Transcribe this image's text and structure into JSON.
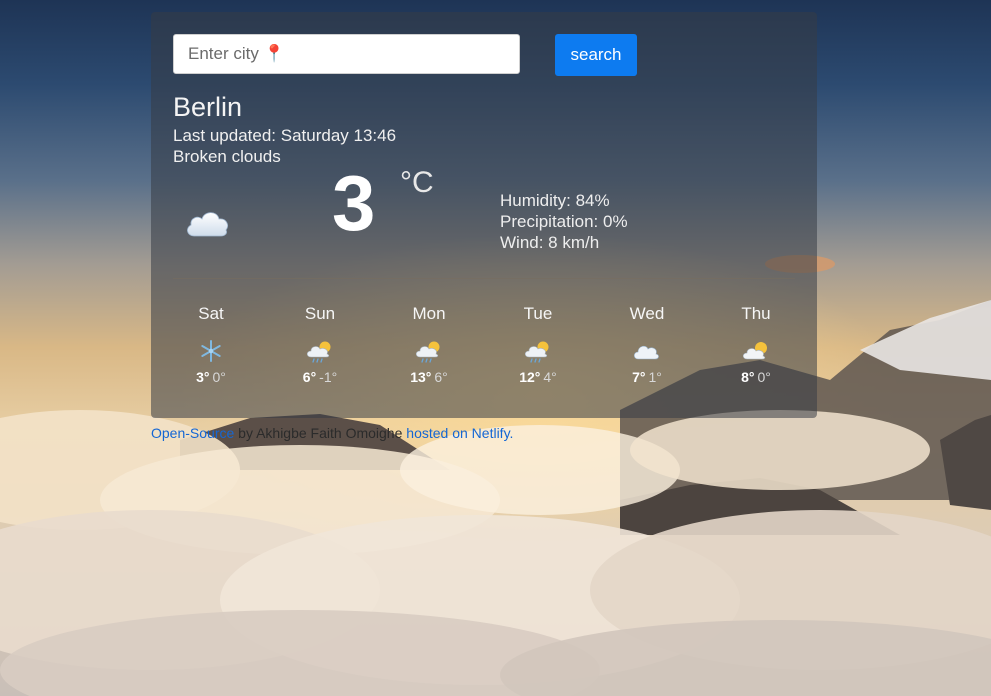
{
  "search": {
    "placeholder": "Enter city 📍",
    "button_label": "search"
  },
  "current": {
    "city": "Berlin",
    "last_updated": "Last updated: Saturday 13:46",
    "description": "Broken clouds",
    "icon": "cloud-icon",
    "temperature": "3",
    "unit": "°C",
    "humidity": "Humidity: 84%",
    "precipitation": "Precipitation: 0%",
    "wind": "Wind: 8 km/h"
  },
  "forecast": [
    {
      "day": "Sat",
      "icon": "snowflake-icon",
      "max": "3°",
      "min": "0°"
    },
    {
      "day": "Sun",
      "icon": "sun-cloud-rain-icon",
      "max": "6°",
      "min": "-1°"
    },
    {
      "day": "Mon",
      "icon": "sun-cloud-rain-icon",
      "max": "13°",
      "min": "6°"
    },
    {
      "day": "Tue",
      "icon": "sun-cloud-rain-icon",
      "max": "12°",
      "min": "4°"
    },
    {
      "day": "Wed",
      "icon": "cloud-icon",
      "max": "7°",
      "min": "1°"
    },
    {
      "day": "Thu",
      "icon": "sun-cloud-icon",
      "max": "8°",
      "min": "0°"
    }
  ],
  "footer": {
    "open_source_link": "Open-Source",
    "author_text": " by Akhigbe Faith Omoighe ",
    "hosted_link": "hosted on Netlify."
  },
  "colors": {
    "accent": "#0d7bf0",
    "link": "#1466d4",
    "card_background": "rgba(55,60,70,0.55)"
  }
}
